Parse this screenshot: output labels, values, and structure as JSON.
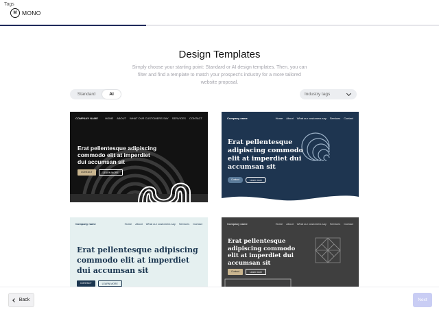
{
  "header": {
    "tags_label": "Tags",
    "logo_mark": "M",
    "logo_text": "MONO",
    "progress_fraction": 0.333
  },
  "main": {
    "title": "Design Templates",
    "subtitle": "Simply choose your starting point: Standard or AI design templates. Then, you can filter and find a template to match your prospect's industry for a more tailored website proposal."
  },
  "filters": {
    "tab_standard": "Standard",
    "tab_ai": "AI",
    "active_tab": "AI",
    "industry_label": "Industry tags"
  },
  "templates": [
    {
      "company": "COMPANY NAME",
      "nav": [
        "HOME",
        "ABOUT",
        "WHAT OUR CUSTOMERS SAY",
        "SERVICES",
        "CONTACT"
      ],
      "heading": "Erat pellentesque adipiscing commodo elit at imperdiet dui accumsan sit",
      "btn_primary": "CONTACT",
      "btn_secondary": "LEARN MORE",
      "bg_color": "#121212",
      "accent_color": "#c9b58f"
    },
    {
      "company": "Company name",
      "nav": [
        "Home",
        "About",
        "What our customers say",
        "Services",
        "Contact"
      ],
      "heading": "Erat pellentesque adipiscing commodo elit at imperdiet dui accumsan sit",
      "btn_primary": "Contact",
      "btn_secondary": "Learn more",
      "bg_color": "#1e3550",
      "accent_color": "#5a7a99"
    },
    {
      "company": "Company name",
      "nav": [
        "Home",
        "About",
        "What our customers say",
        "Services",
        "Contact"
      ],
      "heading": "Erat pellentesque adipiscing commodo elit at imperdiet dui accumsan sit",
      "btn_primary": "CONTACT",
      "btn_secondary": "LEARN MORE",
      "bg_color": "#e5f0f0",
      "accent_color": "#1b3650"
    },
    {
      "company": "Company name",
      "nav": [
        "Home",
        "About",
        "What our customers say",
        "Services",
        "Contact"
      ],
      "heading": "Erat pellentesque adipiscing commodo elit at imperdiet dui accumsan sit",
      "btn_primary": "Contact",
      "btn_secondary": "Learn more",
      "bg_color": "#3f3f3f",
      "accent_color": "#c9b58f"
    }
  ],
  "footer": {
    "back_label": "Back",
    "next_label": "Next",
    "brand_color": "#1f2a5c",
    "next_color": "#c9cdf4"
  }
}
